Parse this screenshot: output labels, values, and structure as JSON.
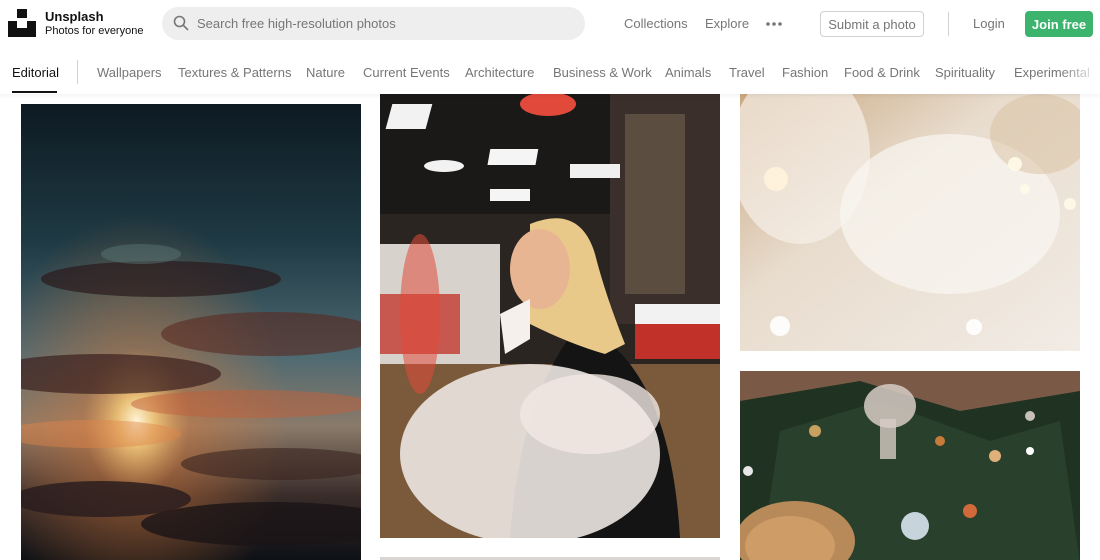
{
  "header": {
    "brand_name": "Unsplash",
    "brand_tagline": "Photos for everyone",
    "search_placeholder": "Search free high-resolution photos",
    "nav": {
      "collections": "Collections",
      "explore": "Explore"
    },
    "submit_label": "Submit a photo",
    "login_label": "Login",
    "join_label": "Join free"
  },
  "icons": {
    "logo": "unsplash-logo",
    "search": "search-icon",
    "more": "more-horizontal-icon"
  },
  "topics": [
    "Editorial",
    "Wallpapers",
    "Textures & Patterns",
    "Nature",
    "Current Events",
    "Architecture",
    "Business & Work",
    "Animals",
    "Travel",
    "Fashion",
    "Food & Drink",
    "Spirituality",
    "Experimental"
  ],
  "active_topic": "Editorial",
  "colors": {
    "accent": "#3cb46e",
    "text_primary": "#111111",
    "text_secondary": "#767676",
    "search_bg": "#eeeeee"
  }
}
